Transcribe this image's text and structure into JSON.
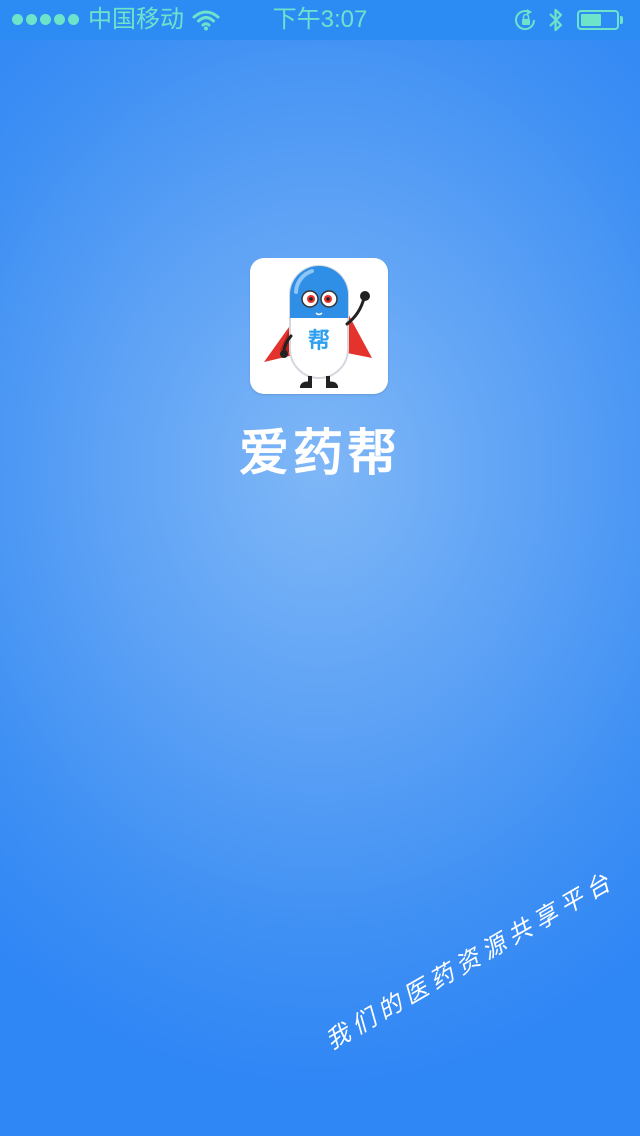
{
  "status_bar": {
    "carrier": "中国移动",
    "time": "下午3:07",
    "signal_bars": 5,
    "battery_level": 0.6,
    "icons": [
      "signal-dots-icon",
      "wifi-icon",
      "rotation-lock-icon",
      "bluetooth-icon",
      "battery-icon"
    ],
    "text_color": "#6de3c9",
    "background_color": "#2d8cf4"
  },
  "splash": {
    "logo_text": "帮",
    "app_name": "爱药帮",
    "slogan": "我们的医药资源共享平台",
    "background_color": "#4a97f4",
    "accent_color": "#2f9ff0"
  }
}
